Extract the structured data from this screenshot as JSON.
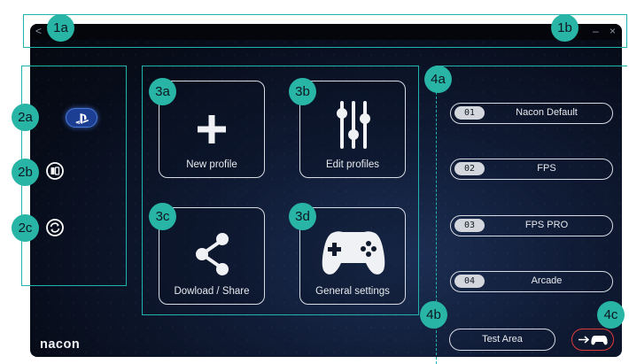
{
  "window": {
    "back_glyph": "<",
    "minimize_glyph": "–",
    "close_glyph": "×"
  },
  "annotations": {
    "a1a": "1a",
    "a1b": "1b",
    "a2a": "2a",
    "a2b": "2b",
    "a2c": "2c",
    "a3a": "3a",
    "a3b": "3b",
    "a3c": "3c",
    "a3d": "3d",
    "a4a": "4a",
    "a4b": "4b",
    "a4c": "4c",
    "color": "#28b5a6"
  },
  "sidebar": {
    "items": [
      {
        "icon": "playstation-icon",
        "selected": true
      },
      {
        "icon": "device-icon"
      },
      {
        "icon": "sync-icon"
      }
    ]
  },
  "tiles": {
    "new_profile": "New profile",
    "edit_profiles": "Edit profiles",
    "download_share": "Dowload / Share",
    "general_settings": "General settings"
  },
  "profiles": [
    {
      "num": "01",
      "name": "Nacon Default"
    },
    {
      "num": "02",
      "name": "FPS"
    },
    {
      "num": "03",
      "name": "FPS PRO"
    },
    {
      "num": "04",
      "name": "Arcade"
    }
  ],
  "actions": {
    "test_area": "Test Area",
    "apply_icon": "arrow-to-controller-icon",
    "apply_color": "#e03a3a"
  },
  "brand": {
    "logo": "nacon"
  }
}
